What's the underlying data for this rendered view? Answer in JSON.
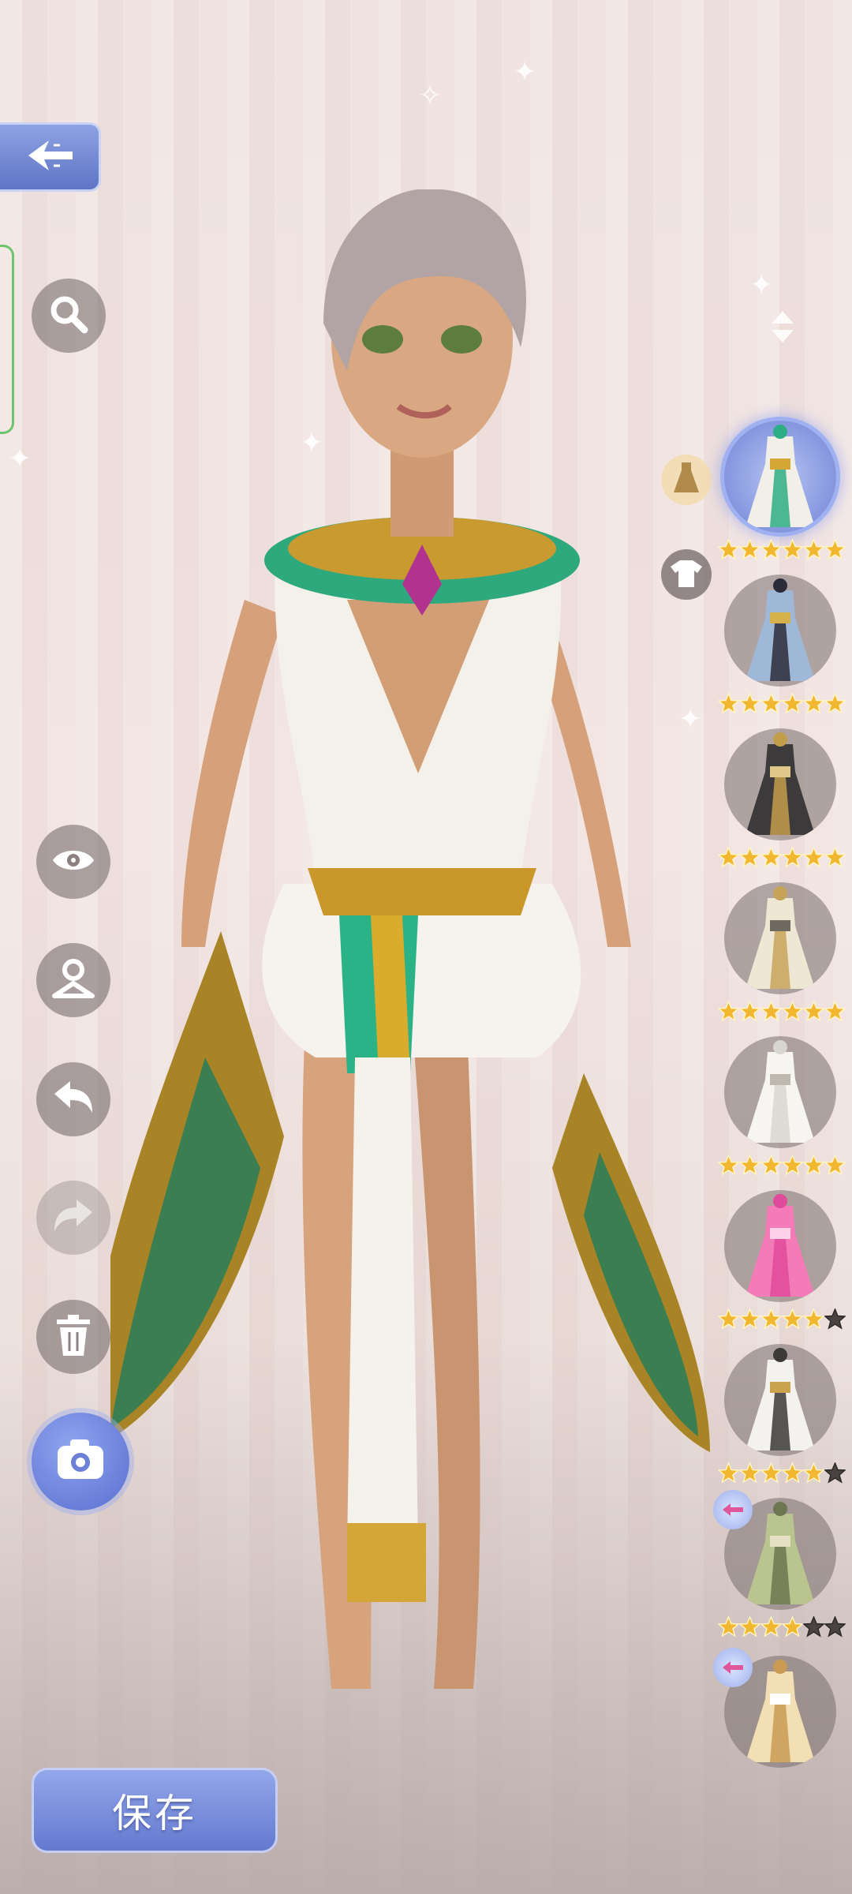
{
  "toolbar": {
    "back_icon": "back-arrow-icon",
    "search_icon": "search-icon",
    "eye_icon": "eye-icon",
    "hanger_icon": "hanger-icon",
    "undo_icon": "undo-icon",
    "redo_icon": "redo-icon",
    "trash_icon": "trash-icon",
    "camera_icon": "camera-icon"
  },
  "categories": [
    {
      "icon": "dress-icon",
      "active": true
    },
    {
      "icon": "top-icon",
      "active": false
    }
  ],
  "items": [
    {
      "name": "outfit-1",
      "stars": 6,
      "max_stars": 6,
      "selected": true
    },
    {
      "name": "outfit-2",
      "stars": 6,
      "max_stars": 6
    },
    {
      "name": "outfit-3",
      "stars": 6,
      "max_stars": 6
    },
    {
      "name": "outfit-4",
      "stars": 6,
      "max_stars": 6
    },
    {
      "name": "outfit-5",
      "stars": 6,
      "max_stars": 6
    },
    {
      "name": "outfit-6",
      "stars": 5,
      "max_stars": 6
    },
    {
      "name": "outfit-7",
      "stars": 5,
      "max_stars": 6
    },
    {
      "name": "outfit-8",
      "stars": 4,
      "max_stars": 6,
      "swap": true
    },
    {
      "name": "outfit-9",
      "swap": true
    }
  ],
  "save": {
    "label": "保存"
  },
  "colors": {
    "accent": "#6a7fd4",
    "star_on": "#f2b731",
    "star_off": "#4a4344"
  }
}
